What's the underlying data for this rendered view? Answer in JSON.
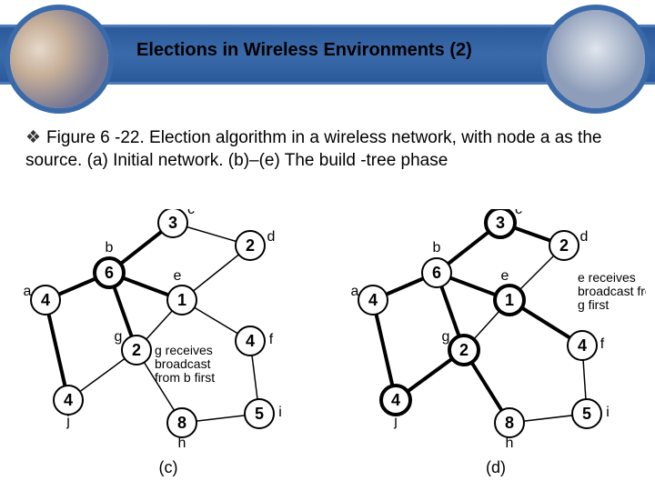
{
  "header": {
    "title": "Elections in Wireless Environments (2)"
  },
  "bullet": "Figure 6 -22. Election algorithm in a wireless network, with node a as the source. (a) Initial network. (b)–(e) The build -tree phase",
  "nodes": {
    "a": {
      "label": "a",
      "cap": "4"
    },
    "b": {
      "label": "b",
      "cap": "6"
    },
    "c": {
      "label": "c",
      "cap": "3"
    },
    "d": {
      "label": "d",
      "cap": "2"
    },
    "e": {
      "label": "e",
      "cap": "1"
    },
    "f": {
      "label": "f",
      "cap": "4"
    },
    "g": {
      "label": "g",
      "cap": "2"
    },
    "h": {
      "label": "h",
      "cap": "8"
    },
    "i": {
      "label": "i",
      "cap": "5"
    },
    "j": {
      "label": "j",
      "cap": "4"
    }
  },
  "annotations": {
    "c": "g receives broadcast from b first",
    "d": "e receives broadcast from g first"
  },
  "captions": {
    "left": "(c)",
    "right": "(d)"
  },
  "chart_data": [
    {
      "type": "graph",
      "caption": "(c)",
      "nodes": [
        {
          "id": "a",
          "cap": 4
        },
        {
          "id": "b",
          "cap": 6
        },
        {
          "id": "c",
          "cap": 3
        },
        {
          "id": "d",
          "cap": 2
        },
        {
          "id": "e",
          "cap": 1
        },
        {
          "id": "f",
          "cap": 4
        },
        {
          "id": "g",
          "cap": 2
        },
        {
          "id": "h",
          "cap": 8
        },
        {
          "id": "i",
          "cap": 5
        },
        {
          "id": "j",
          "cap": 4
        }
      ],
      "edges": [
        {
          "u": "a",
          "v": "b",
          "bold": true
        },
        {
          "u": "a",
          "v": "j",
          "bold": true
        },
        {
          "u": "b",
          "v": "c",
          "bold": true
        },
        {
          "u": "b",
          "v": "e",
          "bold": true
        },
        {
          "u": "b",
          "v": "g",
          "bold": true
        },
        {
          "u": "c",
          "v": "d",
          "bold": false
        },
        {
          "u": "d",
          "v": "e",
          "bold": false
        },
        {
          "u": "e",
          "v": "f",
          "bold": false
        },
        {
          "u": "e",
          "v": "g",
          "bold": false
        },
        {
          "u": "f",
          "v": "i",
          "bold": false
        },
        {
          "u": "g",
          "v": "h",
          "bold": false
        },
        {
          "u": "g",
          "v": "j",
          "bold": false
        },
        {
          "u": "h",
          "v": "i",
          "bold": false
        }
      ],
      "bold_nodes": [
        "b"
      ],
      "annotation": "g receives broadcast from b first"
    },
    {
      "type": "graph",
      "caption": "(d)",
      "nodes": [
        {
          "id": "a",
          "cap": 4
        },
        {
          "id": "b",
          "cap": 6
        },
        {
          "id": "c",
          "cap": 3
        },
        {
          "id": "d",
          "cap": 2
        },
        {
          "id": "e",
          "cap": 1
        },
        {
          "id": "f",
          "cap": 4
        },
        {
          "id": "g",
          "cap": 2
        },
        {
          "id": "h",
          "cap": 8
        },
        {
          "id": "i",
          "cap": 5
        },
        {
          "id": "j",
          "cap": 4
        }
      ],
      "edges": [
        {
          "u": "a",
          "v": "b",
          "bold": true
        },
        {
          "u": "a",
          "v": "j",
          "bold": true
        },
        {
          "u": "b",
          "v": "c",
          "bold": true
        },
        {
          "u": "b",
          "v": "e",
          "bold": true
        },
        {
          "u": "b",
          "v": "g",
          "bold": true
        },
        {
          "u": "c",
          "v": "d",
          "bold": true
        },
        {
          "u": "d",
          "v": "e",
          "bold": false
        },
        {
          "u": "e",
          "v": "f",
          "bold": true
        },
        {
          "u": "e",
          "v": "g",
          "bold": false
        },
        {
          "u": "f",
          "v": "i",
          "bold": false
        },
        {
          "u": "g",
          "v": "h",
          "bold": true
        },
        {
          "u": "g",
          "v": "j",
          "bold": true
        },
        {
          "u": "h",
          "v": "i",
          "bold": false
        }
      ],
      "bold_nodes": [
        "c",
        "e",
        "g",
        "j"
      ],
      "annotation": "e receives broadcast from g first"
    }
  ]
}
